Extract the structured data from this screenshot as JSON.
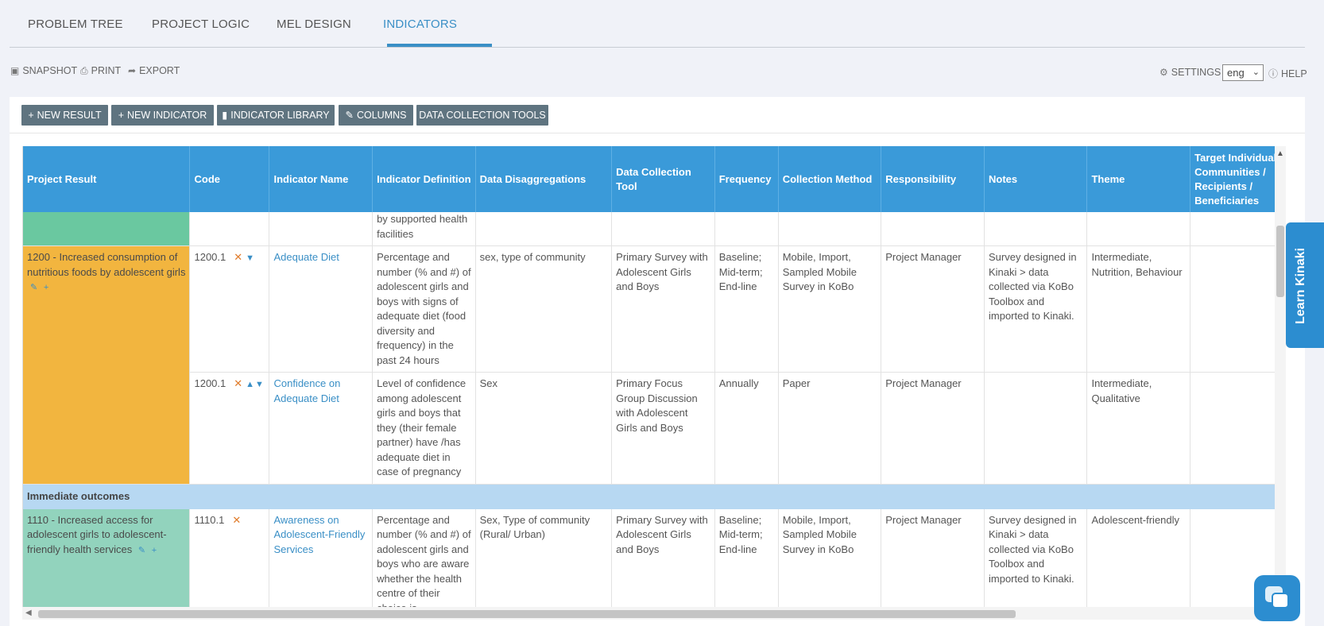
{
  "tabs": [
    {
      "label": "PROBLEM TREE"
    },
    {
      "label": "PROJECT LOGIC"
    },
    {
      "label": "MEL DESIGN"
    },
    {
      "label": "INDICATORS"
    }
  ],
  "actions": {
    "snapshot": "SNAPSHOT",
    "print": "PRINT",
    "export": "EXPORT",
    "settings": "SETTINGS",
    "language": "eng",
    "help": "HELP"
  },
  "toolbar": {
    "new_result": "NEW RESULT",
    "new_indicator": "NEW INDICATOR",
    "indicator_library": "INDICATOR LIBRARY",
    "columns": "COLUMNS",
    "data_collection_tools": "DATA COLLECTION TOOLS"
  },
  "columns": [
    "Project Result",
    "Code",
    "Indicator Name",
    "Indicator Definition",
    "Data Disaggregations",
    "Data Collection Tool",
    "Frequency",
    "Collection Method",
    "Responsibility",
    "Notes",
    "Theme",
    "Target Individual Communities / Recipients / Beneficiaries"
  ],
  "partial_row": {
    "definition": "by supported health facilities"
  },
  "result_1200": {
    "label": "1200 - Increased consumption of nutritious foods by adolescent girls",
    "rows": [
      {
        "code": "1200.1",
        "name": "Adequate Diet",
        "definition": "Percentage and number (% and #) of adolescent girls and boys with signs of adequate diet (food diversity and frequency) in the past 24 hours",
        "disaggregations": "sex, type of community",
        "tool": "Primary Survey with Adolescent Girls and Boys",
        "frequency": "Baseline; Mid-term; End-line",
        "method": "Mobile, Import, Sampled Mobile Survey in KoBo",
        "responsibility": "Project Manager",
        "notes": "Survey designed in Kinaki > data collected via KoBo Toolbox and imported to Kinaki.",
        "theme": "Intermediate, Nutrition, Behaviour"
      },
      {
        "code": "1200.1",
        "name": "Confidence on Adequate Diet",
        "definition": "Level of confidence among adolescent girls and boys that they (their female partner) have /has adequate diet in case of pregnancy",
        "disaggregations": "Sex",
        "tool": "Primary Focus Group Discussion with Adolescent Girls and Boys",
        "frequency": "Annually",
        "method": "Paper",
        "responsibility": "Project Manager",
        "notes": "",
        "theme": "Intermediate, Qualitative"
      }
    ]
  },
  "section": "Immediate outcomes",
  "result_1110": {
    "label": "1110 - Increased access for adolescent girls to adolescent-friendly health services",
    "rows": [
      {
        "code": "1110.1",
        "name": "Awareness on Adolescent-Friendly Services",
        "definition": "Percentage and number (% and #) of adolescent girls and boys who are aware whether the health centre of their choice is",
        "disaggregations": "Sex, Type of community (Rural/ Urban)",
        "tool": "Primary Survey with Adolescent Girls and Boys",
        "frequency": "Baseline; Mid-term; End-line",
        "method": "Mobile, Import, Sampled Mobile Survey in KoBo",
        "responsibility": "Project Manager",
        "notes": "Survey designed in Kinaki > data collected via KoBo Toolbox and imported to Kinaki.",
        "theme": "Adolescent-friendly"
      }
    ]
  },
  "learn_tab": "Learn Kinaki"
}
